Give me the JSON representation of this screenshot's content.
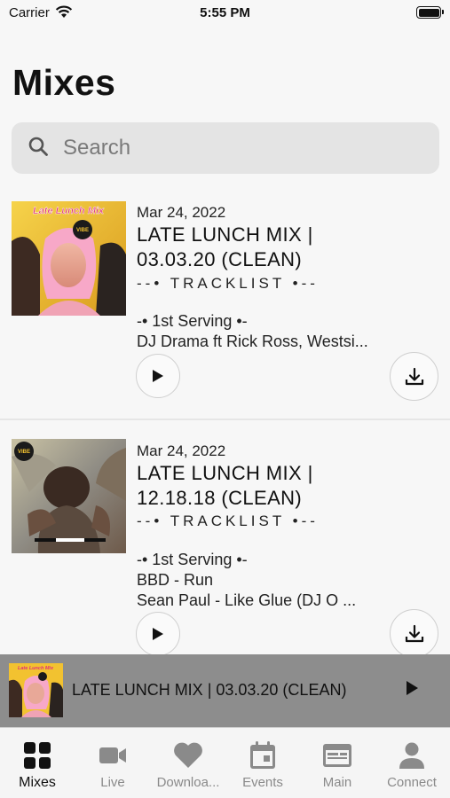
{
  "status_bar": {
    "carrier": "Carrier",
    "time": "5:55 PM"
  },
  "page": {
    "title": "Mixes"
  },
  "search": {
    "placeholder": "Search"
  },
  "mixes": [
    {
      "date": "Mar 24, 2022",
      "title_line1": "LATE LUNCH MIX |",
      "title_line2": "03.03.20 (CLEAN)",
      "tracklist": "--• TRACKLIST •--",
      "serving": "-• 1st Serving •-",
      "lines": [
        "DJ Drama ft Rick Ross, Westsi..."
      ],
      "art_title": "Late Lunch Mix",
      "art_badge": "VIBE"
    },
    {
      "date": "Mar 24, 2022",
      "title_line1": "LATE LUNCH MIX |",
      "title_line2": "12.18.18 (CLEAN)",
      "tracklist": "--• TRACKLIST •--",
      "serving": "-• 1st Serving •-",
      "lines": [
        "BBD - Run",
        "Sean Paul - Like Glue (DJ O ..."
      ],
      "art_badge": "VIBE"
    }
  ],
  "mini_player": {
    "title": "LATE LUNCH MIX | 03.03.20 (CLEAN)",
    "art_title": "Late Lunch Mix"
  },
  "tabs": [
    {
      "label": "Mixes",
      "icon": "grid-icon",
      "active": true
    },
    {
      "label": "Live",
      "icon": "video-camera-icon"
    },
    {
      "label": "Downloa...",
      "icon": "heart-icon"
    },
    {
      "label": "Events",
      "icon": "calendar-icon"
    },
    {
      "label": "Main",
      "icon": "browser-window-icon"
    },
    {
      "label": "Connect",
      "icon": "person-icon"
    }
  ],
  "colors": {
    "accent": "#111111",
    "inactive_tab": "#8a8a8a",
    "mini_player_bg": "#8d8d8d",
    "art_yellow": "#f2c230",
    "art_pink": "#e0307a"
  }
}
